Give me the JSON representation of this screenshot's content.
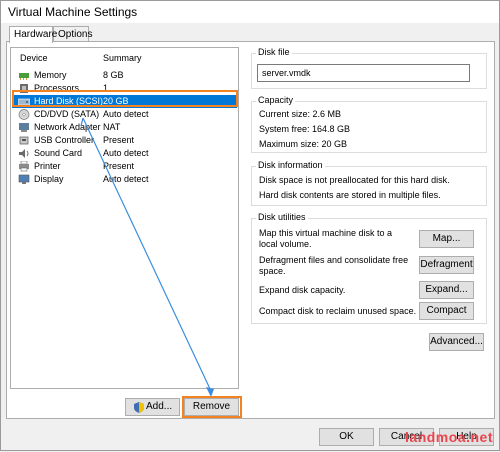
{
  "window": {
    "title": "Virtual Machine Settings"
  },
  "tabs": [
    {
      "label": "Hardware"
    },
    {
      "label": "Options"
    }
  ],
  "device_list": {
    "headers": {
      "device": "Device",
      "summary": "Summary"
    },
    "rows": [
      {
        "device": "Memory",
        "summary": "8 GB",
        "icon": "memory-icon"
      },
      {
        "device": "Processors",
        "summary": "1",
        "icon": "processor-icon"
      },
      {
        "device": "Hard Disk (SCSI)",
        "summary": "20 GB",
        "icon": "hard-disk-icon",
        "selected": true
      },
      {
        "device": "CD/DVD (SATA)",
        "summary": "Auto detect",
        "icon": "cd-dvd-icon"
      },
      {
        "device": "Network Adapter",
        "summary": "NAT",
        "icon": "network-adapter-icon"
      },
      {
        "device": "USB Controller",
        "summary": "Present",
        "icon": "usb-icon"
      },
      {
        "device": "Sound Card",
        "summary": "Auto detect",
        "icon": "sound-card-icon"
      },
      {
        "device": "Printer",
        "summary": "Present",
        "icon": "printer-icon"
      },
      {
        "device": "Display",
        "summary": "Auto detect",
        "icon": "display-icon"
      }
    ]
  },
  "list_buttons": {
    "add_label": "Add...",
    "remove_label": "Remove"
  },
  "disk_file": {
    "label": "Disk file",
    "value": "server.vmdk"
  },
  "capacity": {
    "label": "Capacity",
    "current_size": "Current size: 2.6 MB",
    "system_free": "System free: 164.8 GB",
    "maximum_size": "Maximum size: 20 GB"
  },
  "disk_information": {
    "label": "Disk information",
    "line1": "Disk space is not preallocated for this hard disk.",
    "line2": "Hard disk contents are stored in multiple files."
  },
  "disk_utilities": {
    "label": "Disk utilities",
    "map_text": "Map this virtual machine disk to a local volume.",
    "map_button": "Map...",
    "defrag_text": "Defragment files and consolidate free space.",
    "defrag_button": "Defragment",
    "expand_text": "Expand disk capacity.",
    "expand_button": "Expand...",
    "compact_text": "Compact disk to reclaim unused space.",
    "compact_button": "Compact"
  },
  "advanced_button": "Advanced...",
  "footer": {
    "ok_label": "OK",
    "cancel_label": "Cancel",
    "help_label": "Help"
  },
  "watermark": "landmoa.net",
  "colors": {
    "selection": "#0078d7",
    "highlight": "#f58220",
    "arrow": "#3a8de0",
    "watermark": "#e8454e"
  }
}
